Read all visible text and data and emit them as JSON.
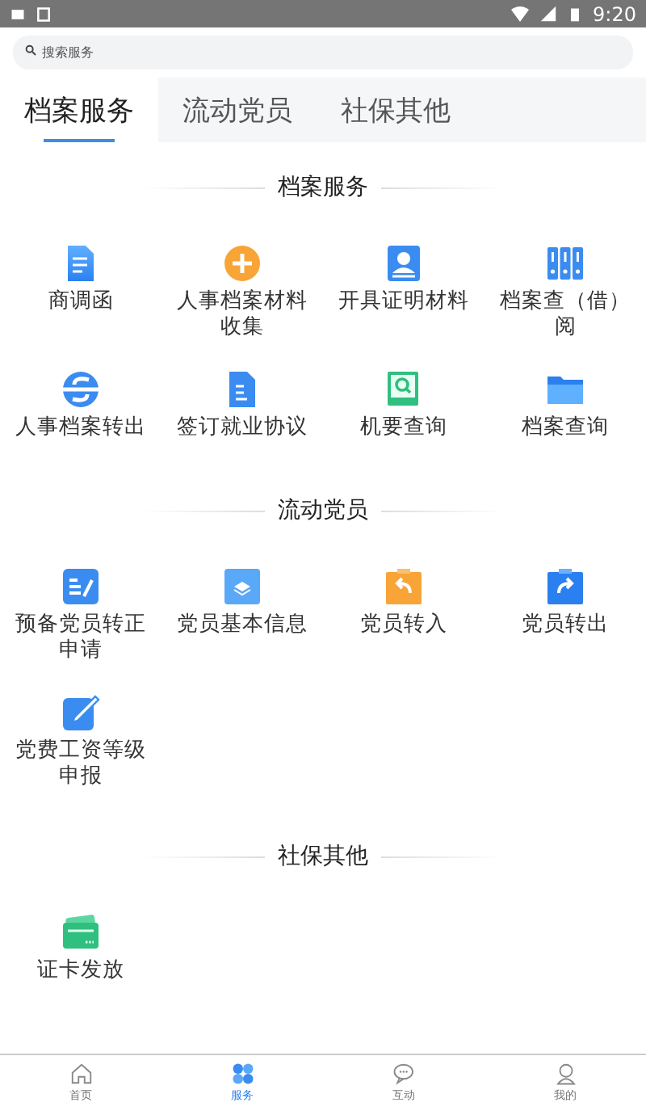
{
  "status_bar": {
    "time": "9:20"
  },
  "search": {
    "placeholder": "搜索服务"
  },
  "tabs": [
    {
      "label": "档案服务",
      "selected": true
    },
    {
      "label": "流动党员",
      "selected": false
    },
    {
      "label": "社保其他",
      "selected": false
    }
  ],
  "sections": [
    {
      "title": "档案服务",
      "items": [
        "商调函",
        "人事档案材料收集",
        "开具证明材料",
        "档案查（借）阅",
        "人事档案转出",
        "签订就业协议",
        "机要查询",
        "档案查询"
      ]
    },
    {
      "title": "流动党员",
      "items": [
        "预备党员转正申请",
        "党员基本信息",
        "党员转入",
        "党员转出",
        "党费工资等级申报"
      ]
    },
    {
      "title": "社保其他",
      "items": [
        "证卡发放"
      ]
    }
  ],
  "bottom_nav": [
    {
      "label": "首页",
      "selected": false
    },
    {
      "label": "服务",
      "selected": true
    },
    {
      "label": "互动",
      "selected": false
    },
    {
      "label": "我的",
      "selected": false
    }
  ]
}
